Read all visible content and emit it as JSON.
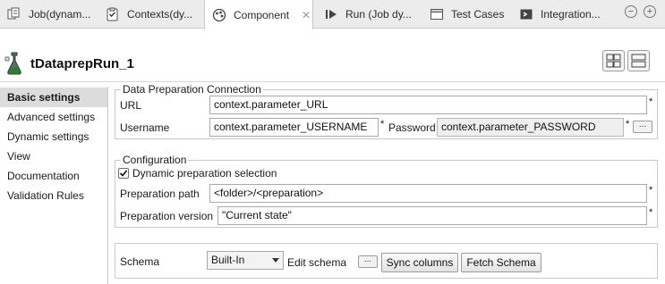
{
  "tabs": [
    {
      "label": "Job(dynam...",
      "icon": "job-icon",
      "active": false
    },
    {
      "label": "Contexts(dy...",
      "icon": "contexts-icon",
      "active": false
    },
    {
      "label": "Component",
      "icon": "component-icon",
      "active": true
    },
    {
      "label": "Run (Job dy...",
      "icon": "run-icon",
      "active": false
    },
    {
      "label": "Test Cases",
      "icon": "test-cases-icon",
      "active": false
    },
    {
      "label": "Integration...",
      "icon": "integration-icon",
      "active": false
    }
  ],
  "window_controls": {
    "minimize": "−",
    "maximize": "+"
  },
  "component": {
    "title": "tDataprepRun_1",
    "icon": "dataprep-component-icon"
  },
  "nav": [
    {
      "label": "Basic settings",
      "active": true
    },
    {
      "label": "Advanced settings",
      "active": false
    },
    {
      "label": "Dynamic settings",
      "active": false
    },
    {
      "label": "View",
      "active": false
    },
    {
      "label": "Documentation",
      "active": false
    },
    {
      "label": "Validation Rules",
      "active": false
    }
  ],
  "connection": {
    "legend": "Data Preparation Connection",
    "url_label": "URL",
    "url_value": "context.parameter_URL",
    "username_label": "Username",
    "username_value": "context.parameter_USERNAME",
    "password_label": "Password",
    "password_value": "context.parameter_PASSWORD",
    "required_mark": "*",
    "browse_label": "..."
  },
  "configuration": {
    "legend": "Configuration",
    "dynamic_checkbox_label": "Dynamic preparation selection",
    "dynamic_checked": true,
    "path_label": "Preparation path",
    "path_value": "<folder>/<preparation>",
    "version_label": "Preparation version",
    "version_value": "\"Current state\""
  },
  "schema": {
    "label": "Schema",
    "selected": "Built-In",
    "edit_label": "Edit schema",
    "edit_button": "...",
    "sync_button": "Sync columns",
    "fetch_button": "Fetch Schema"
  },
  "colors": {
    "active_nav_bg": "#dcdcdc",
    "tab_bar_bg": "#ececec",
    "component_icon_accent": "#2e7d32"
  }
}
